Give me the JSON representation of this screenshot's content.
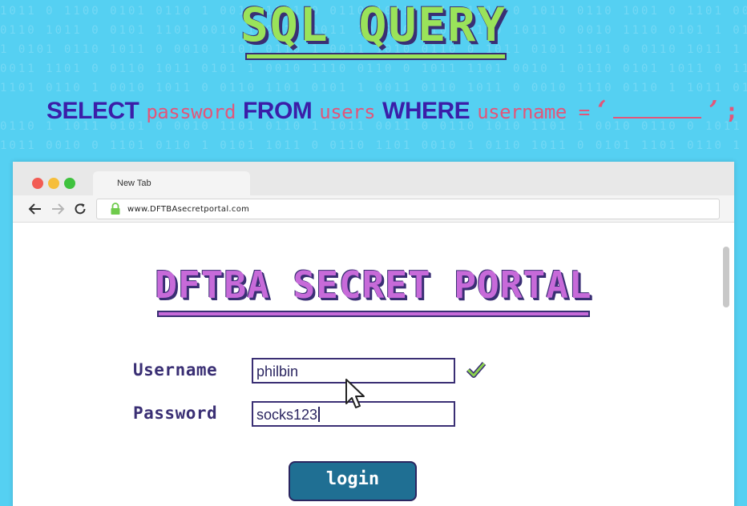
{
  "header": {
    "title": "SQL QUERY",
    "query": {
      "select": "SELECT",
      "column": "password",
      "from": "FROM",
      "table": "users",
      "where": "WHERE",
      "field": "username",
      "equals": "=",
      "open_quote": "‘",
      "close_quote": "’",
      "terminator": ";"
    }
  },
  "browser": {
    "tab_label": "New Tab",
    "url": "www.DFTBAsecretportal.com",
    "icons": [
      "back-arrow-icon",
      "forward-arrow-icon",
      "reload-icon",
      "lock-icon"
    ]
  },
  "portal": {
    "title": "DFTBA SECRET PORTAL",
    "username_label": "Username",
    "username_value": "philbin",
    "password_label": "Password",
    "password_value": "socks123",
    "login_label": "login"
  },
  "colors": {
    "background": "#55d0f2",
    "sql_title": "#9ae35a",
    "keyword": "#3b1ea8",
    "identifier": "#e2567a",
    "portal_title": "#c76ad9",
    "outline": "#3a2f74",
    "login_button": "#1f6f93"
  }
}
